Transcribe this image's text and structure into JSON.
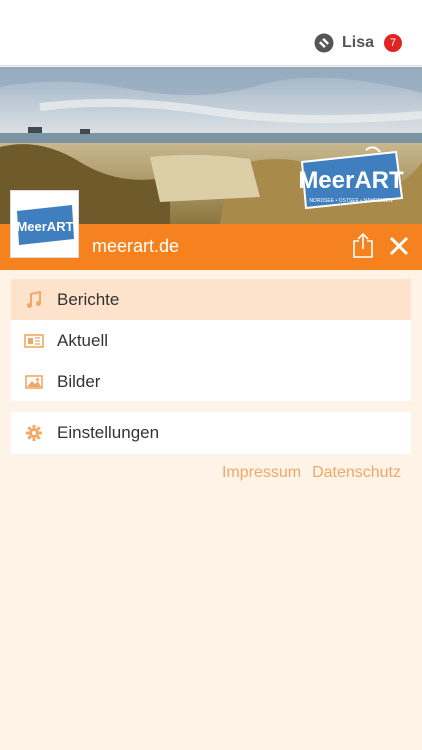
{
  "header": {
    "user_name": "Lisa",
    "notification_count": "7"
  },
  "site": {
    "name": "meerart.de",
    "logo_text": "MeerART",
    "tagline": "NORDSEE • OSTSEE • NAHREISEN",
    "accent_color": "#f5821f"
  },
  "menu": {
    "items": [
      {
        "label": "Berichte",
        "icon": "music-note-icon",
        "active": true
      },
      {
        "label": "Aktuell",
        "icon": "newspaper-icon",
        "active": false
      },
      {
        "label": "Bilder",
        "icon": "image-icon",
        "active": false
      }
    ],
    "settings_label": "Einstellungen"
  },
  "footer": {
    "impressum": "Impressum",
    "datenschutz": "Datenschutz"
  }
}
